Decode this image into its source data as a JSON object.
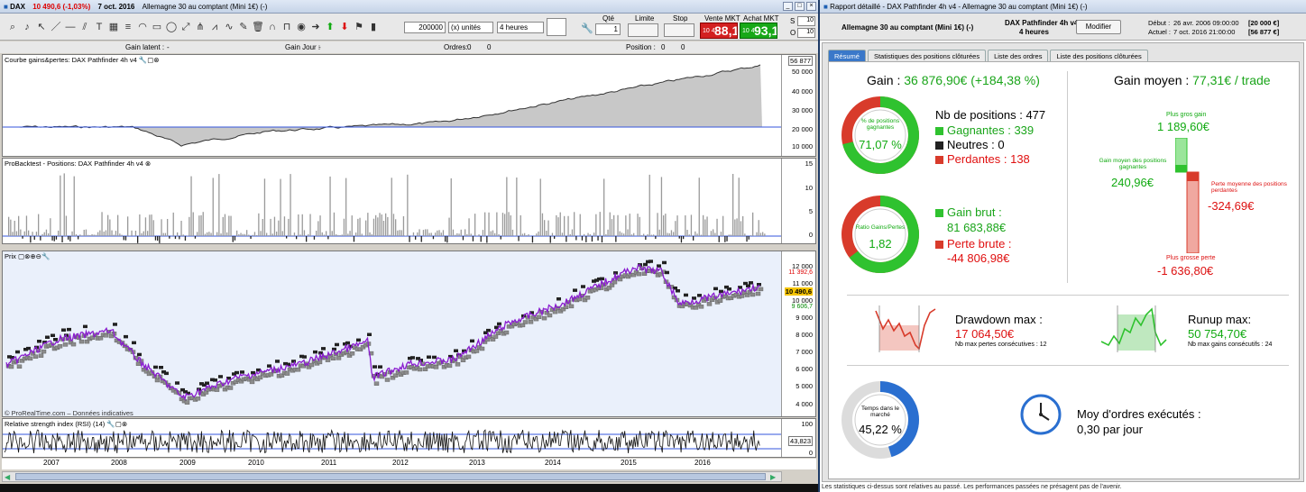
{
  "left_window": {
    "title_symbol": "DAX",
    "title_price": "10 490,6 (-1,03%)",
    "title_date": "7 oct. 2016",
    "title_desc": "Allemagne 30 au comptant (Mini 1€) (-)",
    "qte_label": "Qté",
    "qte_value": "1",
    "limite_label": "Limite",
    "stop_label": "Stop",
    "vente_label": "Vente MKT",
    "achat_label": "Achat MKT",
    "vente_small": "10 4",
    "vente_big": "88,1",
    "achat_small": "10 4",
    "achat_big": "93,1",
    "units_value": "200000",
    "units_select": "(x) unités",
    "period_select": "4 heures",
    "s_label": "S",
    "s_value": "10",
    "o_label": "O",
    "o_value": "10",
    "status": {
      "gain_latent": "Gain latent :",
      "gain_latent_val": "-",
      "gain_jour": "Gain Jour :",
      "gain_jour_val": "-",
      "ordres": "Ordres:",
      "ordres_val": "0",
      "ordres_val2": "0",
      "position": "Position :",
      "position_val": "0",
      "position_val2": "0"
    },
    "pane1": {
      "title": "Courbe gains&pertes: DAX Pathfinder 4h v4",
      "last": "56 877",
      "ticks": [
        "50 000",
        "40 000",
        "30 000",
        "20 000",
        "10 000"
      ]
    },
    "pane2": {
      "title": "ProBacktest - Positions: DAX Pathfinder 4h v4",
      "ticks": [
        "15",
        "10",
        "5",
        "0"
      ]
    },
    "pane3": {
      "title": "Prix",
      "ticks": [
        "12 000",
        "11 000",
        "10 000",
        "9 000",
        "8 000",
        "7 000",
        "6 000",
        "5 000",
        "4 000"
      ],
      "markers": [
        "11 392,6",
        "10 490,6",
        "9 606,7"
      ],
      "watermark": "© ProRealTime.com – Données indicatives"
    },
    "pane4": {
      "title": "Relative strength index (RSI) (14)",
      "ticks": [
        "100",
        "50",
        "0"
      ],
      "last": "43,823"
    },
    "xaxis": [
      "2007",
      "2008",
      "2009",
      "2010",
      "2011",
      "2012",
      "2013",
      "2014",
      "2015",
      "2016"
    ]
  },
  "right_window": {
    "title": "Rapport détaillé - DAX Pathfinder 4h v4 - Allemagne 30 au comptant (Mini 1€) (-)",
    "header_instrument": "Allemagne 30 au comptant (Mini 1€) (-)",
    "header_system": "DAX Pathfinder 4h v4",
    "header_period": "4 heures",
    "modify_button": "Modifier",
    "debut_label": "Début :",
    "debut_date": "26 avr. 2006 09:00:00",
    "debut_val": "[20 000 €]",
    "actuel_label": "Actuel :",
    "actuel_date": "7 oct. 2016 21:00:00",
    "actuel_val": "[56 877 €]",
    "tabs": [
      "Résumé",
      "Statistiques des positions clôturées",
      "Liste des ordres",
      "Liste des positions clôturées"
    ],
    "gain_label": "Gain :",
    "gain_value": "36 876,90€ (+184,38 %)",
    "donut1_label": "% de positions gagnantes",
    "donut1_value": "71,07 %",
    "donut1_pct": 71.07,
    "nb_positions": "Nb de positions : 477",
    "gagnantes": "Gagnantes : 339",
    "neutres": "Neutres : 0",
    "perdantes": "Perdantes : 138",
    "donut2_label": "Ratio Gains/Pertes",
    "donut2_value": "1,82",
    "donut2_pct": 64.6,
    "gain_brut_label": "Gain brut :",
    "gain_brut_value": "81 683,88€",
    "perte_brute_label": "Perte brute :",
    "perte_brute_value": "-44 806,98€",
    "gain_moyen_label": "Gain moyen :",
    "gain_moyen_value": "77,31€ / trade",
    "plus_gros_gain_label": "Plus gros gain",
    "plus_gros_gain_value": "1 189,60€",
    "gain_moyen_pos_label": "Gain moyen des positions gagnantes",
    "gain_moyen_pos_value": "240,96€",
    "perte_moyenne_label": "Perte moyenne des positions perdantes",
    "perte_moyenne_value": "-324,69€",
    "plus_grosse_perte_label": "Plus grosse perte",
    "plus_grosse_perte_value": "-1 636,80€",
    "drawdown_label": "Drawdown max :",
    "drawdown_value": "17 064,50€",
    "drawdown_sub": "Nb max pertes consécutives : 12",
    "runup_label": "Runup max:",
    "runup_value": "50 754,70€",
    "runup_sub": "Nb max gains consécutifs : 24",
    "temps_label": "Temps dans le marché",
    "temps_value": "45,22 %",
    "temps_pct": 45.22,
    "ordres_label": "Moy d'ordres exécutés :",
    "ordres_value": "0,30 par jour",
    "footer": "Les statistiques ci-dessus sont relatives au passé. Les performances passées ne présagent pas de l'avenir."
  },
  "colors": {
    "green": "#2fc22f",
    "red": "#d83b2b",
    "blue": "#2a6fd0",
    "purple": "#8a1ccf"
  }
}
